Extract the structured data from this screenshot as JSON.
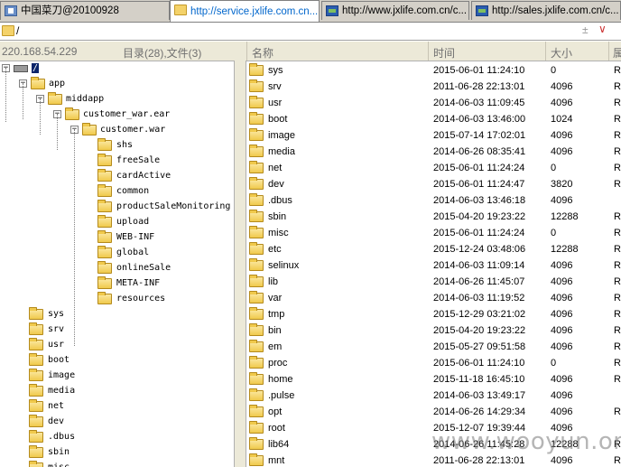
{
  "tabs": [
    {
      "label": "中国菜刀@20100928",
      "icon": "browser-icon",
      "active": false
    },
    {
      "label": "http://service.jxlife.com.cn...",
      "icon": "folder-icon",
      "active": true
    },
    {
      "label": "http://www.jxlife.com.cn/c...",
      "icon": "globe-icon",
      "active": false
    },
    {
      "label": "http://sales.jxlife.com.cn/c...",
      "icon": "globe-icon",
      "active": false
    }
  ],
  "address": {
    "path": "/",
    "plusminus": "±",
    "dropdown": "∨"
  },
  "header": {
    "ip": "220.168.54.229",
    "summary": "目录(28),文件(3)",
    "col_name": "名称",
    "col_time": "时间",
    "col_size": "大小",
    "col_attr": "属"
  },
  "tree": [
    {
      "label": "/",
      "expanded": true,
      "selected": true,
      "drive": true
    },
    {
      "label": "app",
      "expanded": true
    },
    {
      "label": "middapp",
      "expanded": true
    },
    {
      "label": "customer_war.ear",
      "expanded": true
    },
    {
      "label": "customer.war",
      "expanded": true
    },
    {
      "label": "shs"
    },
    {
      "label": "freeSale"
    },
    {
      "label": "cardActive"
    },
    {
      "label": "common"
    },
    {
      "label": "productSaleMonitoring"
    },
    {
      "label": "upload"
    },
    {
      "label": "WEB-INF"
    },
    {
      "label": "global"
    },
    {
      "label": "onlineSale"
    },
    {
      "label": "META-INF"
    },
    {
      "label": "resources"
    },
    {
      "label": "sys"
    },
    {
      "label": "srv"
    },
    {
      "label": "usr"
    },
    {
      "label": "boot"
    },
    {
      "label": "image"
    },
    {
      "label": "media"
    },
    {
      "label": "net"
    },
    {
      "label": "dev"
    },
    {
      "label": ".dbus"
    },
    {
      "label": "sbin"
    },
    {
      "label": "misc"
    }
  ],
  "files": [
    {
      "name": "sys",
      "time": "2015-06-01 11:24:10",
      "size": "0",
      "attr": "R"
    },
    {
      "name": "srv",
      "time": "2011-06-28 22:13:01",
      "size": "4096",
      "attr": "R"
    },
    {
      "name": "usr",
      "time": "2014-06-03 11:09:45",
      "size": "4096",
      "attr": "R"
    },
    {
      "name": "boot",
      "time": "2014-06-03 13:46:00",
      "size": "1024",
      "attr": "R"
    },
    {
      "name": "image",
      "time": "2015-07-14 17:02:01",
      "size": "4096",
      "attr": "R"
    },
    {
      "name": "media",
      "time": "2014-06-26 08:35:41",
      "size": "4096",
      "attr": "R"
    },
    {
      "name": "net",
      "time": "2015-06-01 11:24:24",
      "size": "0",
      "attr": "R"
    },
    {
      "name": "dev",
      "time": "2015-06-01 11:24:47",
      "size": "3820",
      "attr": "R"
    },
    {
      "name": ".dbus",
      "time": "2014-06-03 13:46:18",
      "size": "4096",
      "attr": ""
    },
    {
      "name": "sbin",
      "time": "2015-04-20 19:23:22",
      "size": "12288",
      "attr": "R"
    },
    {
      "name": "misc",
      "time": "2015-06-01 11:24:24",
      "size": "0",
      "attr": "R"
    },
    {
      "name": "etc",
      "time": "2015-12-24 03:48:06",
      "size": "12288",
      "attr": "R"
    },
    {
      "name": "selinux",
      "time": "2014-06-03 11:09:14",
      "size": "4096",
      "attr": "R"
    },
    {
      "name": "lib",
      "time": "2014-06-26 11:45:07",
      "size": "4096",
      "attr": "R"
    },
    {
      "name": "var",
      "time": "2014-06-03 11:19:52",
      "size": "4096",
      "attr": "R"
    },
    {
      "name": "tmp",
      "time": "2015-12-29 03:21:02",
      "size": "4096",
      "attr": "R"
    },
    {
      "name": "bin",
      "time": "2015-04-20 19:23:22",
      "size": "4096",
      "attr": "R"
    },
    {
      "name": "em",
      "time": "2015-05-27 09:51:58",
      "size": "4096",
      "attr": "R"
    },
    {
      "name": "proc",
      "time": "2015-06-01 11:24:10",
      "size": "0",
      "attr": "R"
    },
    {
      "name": "home",
      "time": "2015-11-18 16:45:10",
      "size": "4096",
      "attr": "R"
    },
    {
      "name": ".pulse",
      "time": "2014-06-03 13:49:17",
      "size": "4096",
      "attr": ""
    },
    {
      "name": "opt",
      "time": "2014-06-26 14:29:34",
      "size": "4096",
      "attr": "R"
    },
    {
      "name": "root",
      "time": "2015-12-07 19:39:44",
      "size": "4096",
      "attr": ""
    },
    {
      "name": "lib64",
      "time": "2014-06-26 11:45:28",
      "size": "12288",
      "attr": "R"
    },
    {
      "name": "mnt",
      "time": "2011-06-28 22:13:01",
      "size": "4096",
      "attr": "R"
    }
  ],
  "watermark": "www.wooyun.org",
  "colors": {
    "selection": "#0a246a",
    "active_tab_text": "#0066cc",
    "folder": "#f0c94c"
  }
}
